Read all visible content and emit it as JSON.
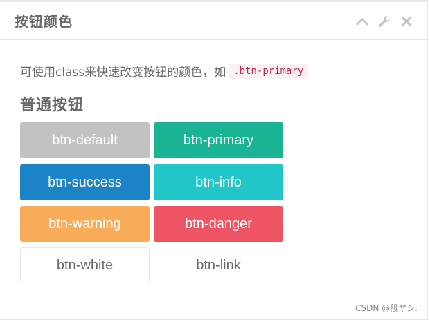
{
  "panel": {
    "title": "按钮颜色",
    "tools": [
      {
        "icon": "chevron-up-icon"
      },
      {
        "icon": "wrench-icon"
      },
      {
        "icon": "close-icon"
      }
    ]
  },
  "intro": {
    "text": "可使用class来快速改变按钮的颜色，如",
    "code": ".btn-primary"
  },
  "section_title": "普通按钮",
  "buttons": {
    "default": {
      "label": "btn-default",
      "bg": "#c2c2c2",
      "fg": "#ffffff"
    },
    "primary": {
      "label": "btn-primary",
      "bg": "#1ab394",
      "fg": "#ffffff"
    },
    "success": {
      "label": "btn-success",
      "bg": "#1c84c6",
      "fg": "#ffffff"
    },
    "info": {
      "label": "btn-info",
      "bg": "#23c6c8",
      "fg": "#ffffff"
    },
    "warning": {
      "label": "btn-warning",
      "bg": "#f8ac59",
      "fg": "#ffffff"
    },
    "danger": {
      "label": "btn-danger",
      "bg": "#ed5565",
      "fg": "#ffffff"
    },
    "white": {
      "label": "btn-white",
      "bg": "#ffffff",
      "fg": "#676a6c",
      "border": "#e7eaec"
    },
    "link": {
      "label": "btn-link",
      "bg": "#ffffff",
      "fg": "#676a6c"
    }
  },
  "watermark": "CSDN @段ヤシ."
}
